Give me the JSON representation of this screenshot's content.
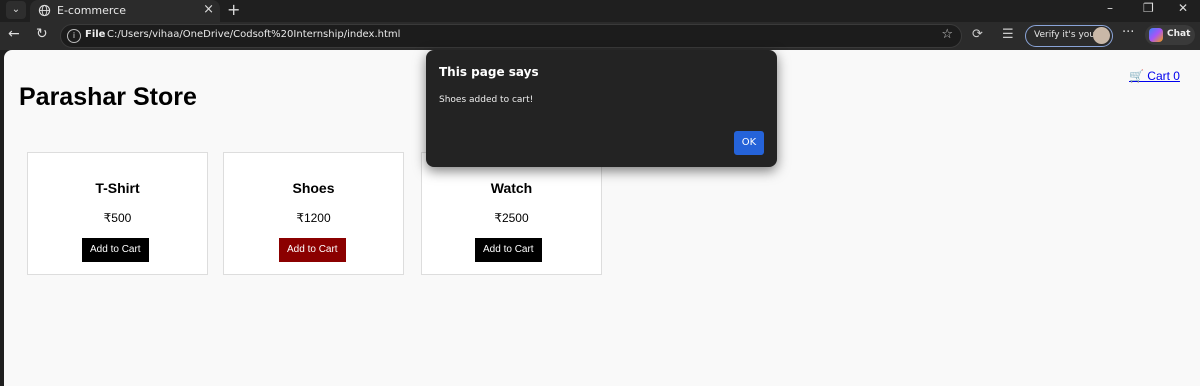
{
  "browser": {
    "tab": {
      "title": "E-commerce"
    },
    "address": {
      "scheme_label": "File",
      "url": "C:/Users/vihaa/OneDrive/Codsoft%20Internship/index.html"
    },
    "verify_label": "Verify it's you",
    "chat_label": "Chat"
  },
  "page": {
    "store_name": "Parashar Store",
    "cart_text": "🛒 Cart 0",
    "products": [
      {
        "name": "T-Shirt",
        "price": "₹500",
        "button": "Add to Cart"
      },
      {
        "name": "Shoes",
        "price": "₹1200",
        "button": "Add to Cart"
      },
      {
        "name": "Watch",
        "price": "₹2500",
        "button": "Add to Cart"
      }
    ]
  },
  "dialog": {
    "title": "This page says",
    "message": "Shoes added to cart!",
    "ok_label": "OK"
  },
  "colors": {
    "active_button": "#8b0000",
    "dialog_ok": "#2563d9"
  }
}
